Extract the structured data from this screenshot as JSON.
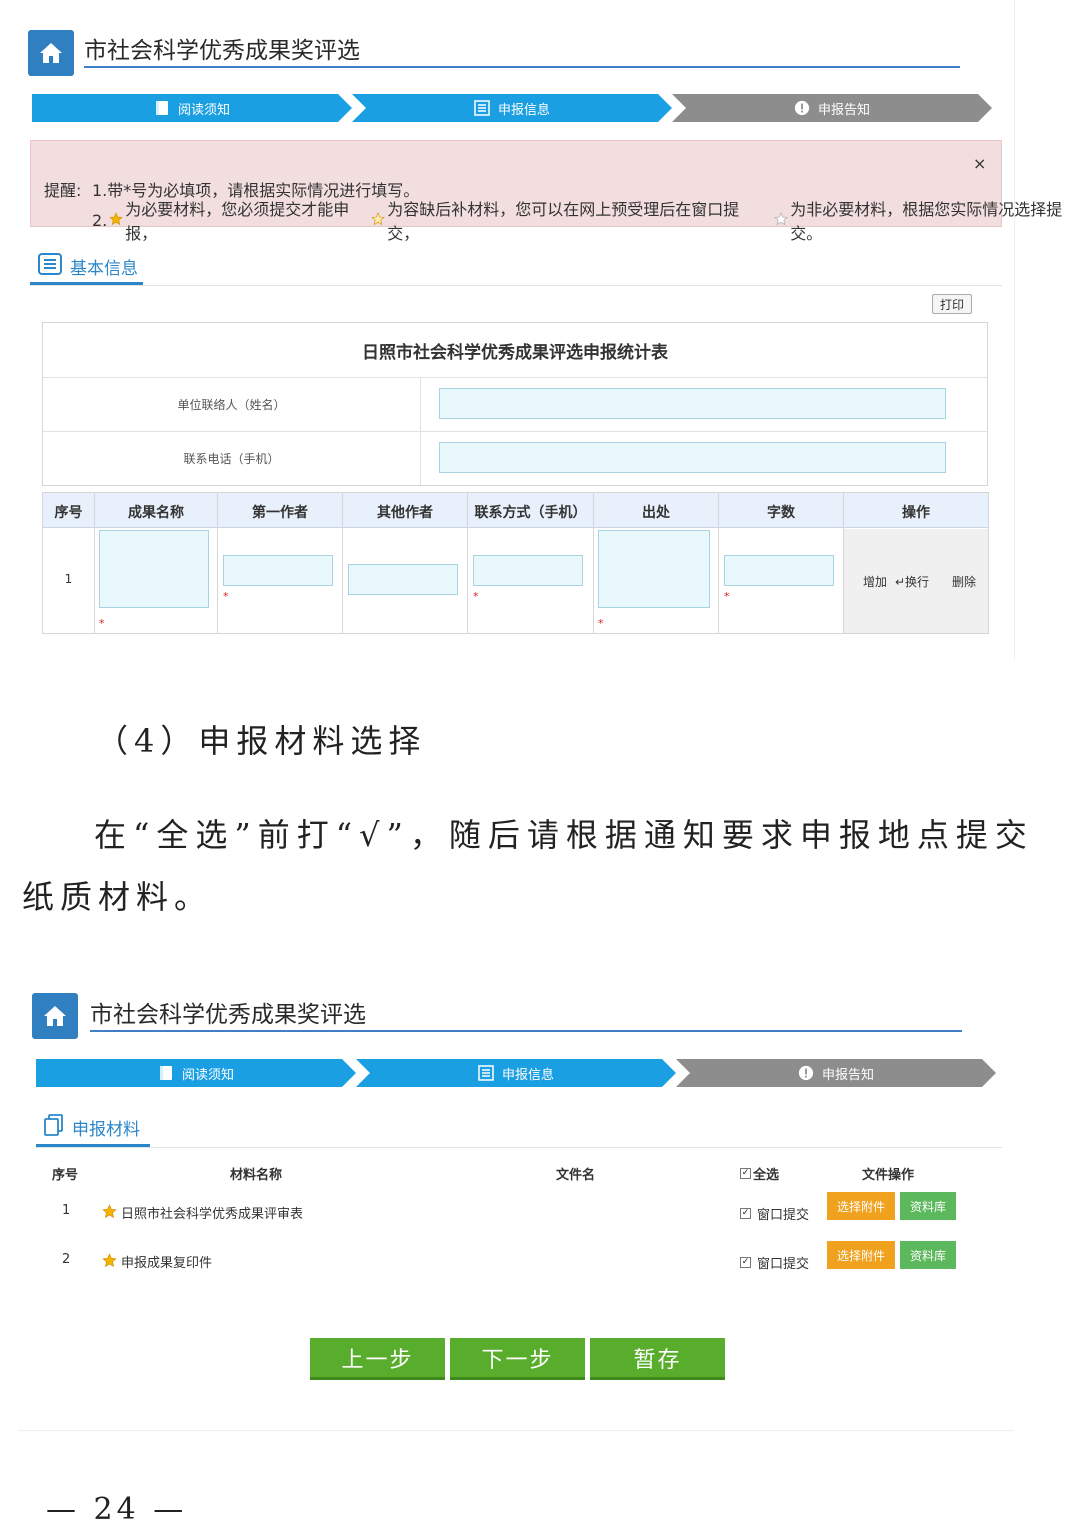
{
  "screen1": {
    "title": "市社会科学优秀成果奖评选",
    "steps": [
      {
        "label": "阅读须知",
        "state": "done"
      },
      {
        "label": "申报信息",
        "state": "current"
      },
      {
        "label": "申报告知",
        "state": "pending"
      }
    ],
    "alert": {
      "prefix": "提醒:",
      "line1": "1.带*号为必填项，请根据实际情况进行填写。",
      "line2_a": "2.",
      "line2_b": "为必要材料，您必须提交才能申报，",
      "line2_c": "为容缺后补材料，您可以在网上预受理后在窗口提交，",
      "line2_d": "为非必要材料，根据您实际情况选择提交。",
      "close": "×"
    },
    "section": "基本信息",
    "print": "打印",
    "table_title": "日照市社会科学优秀成果评选申报统计表",
    "contact_name_label": "单位联络人（姓名）",
    "contact_phone_label": "联系电话（手机）",
    "columns": [
      "序号",
      "成果名称",
      "第一作者",
      "其他作者",
      "联系方式（手机）",
      "出处",
      "字数",
      "操作"
    ],
    "row": {
      "index": "1",
      "required_mark": "*",
      "ops": {
        "add": "增加",
        "wrap": "↵换行",
        "delete": "删除"
      }
    }
  },
  "doc": {
    "heading": "（4）申报材料选择",
    "para_line1": "在“全选”前打“√”，随后请根据通知要求申报地点提交",
    "para_line2": "纸质材料。"
  },
  "screen2": {
    "title": "市社会科学优秀成果奖评选",
    "steps": [
      {
        "label": "阅读须知",
        "state": "done"
      },
      {
        "label": "申报信息",
        "state": "current"
      },
      {
        "label": "申报告知",
        "state": "pending"
      }
    ],
    "section": "申报材料",
    "headers": {
      "index": "序号",
      "name": "材料名称",
      "file": "文件名",
      "select_all": "全选",
      "ops": "文件操作"
    },
    "rows": [
      {
        "index": "1",
        "name": "日照市社会科学优秀成果评审表",
        "submit": "窗口提交",
        "checked": true
      },
      {
        "index": "2",
        "name": "申报成果复印件",
        "submit": "窗口提交",
        "checked": true
      }
    ],
    "btn_attach": "选择附件",
    "btn_library": "资料库",
    "buttons": {
      "prev": "上一步",
      "next": "下一步",
      "save": "暂存"
    }
  },
  "page_number": "— 24 —",
  "colors": {
    "step_blue": "#1a9fe3",
    "step_gray": "#8d8d8d",
    "brand_blue": "#2f7fc1",
    "alert_bg": "#f2dede",
    "btn_green": "#59ad2c",
    "btn_orange": "#f0a11e"
  }
}
